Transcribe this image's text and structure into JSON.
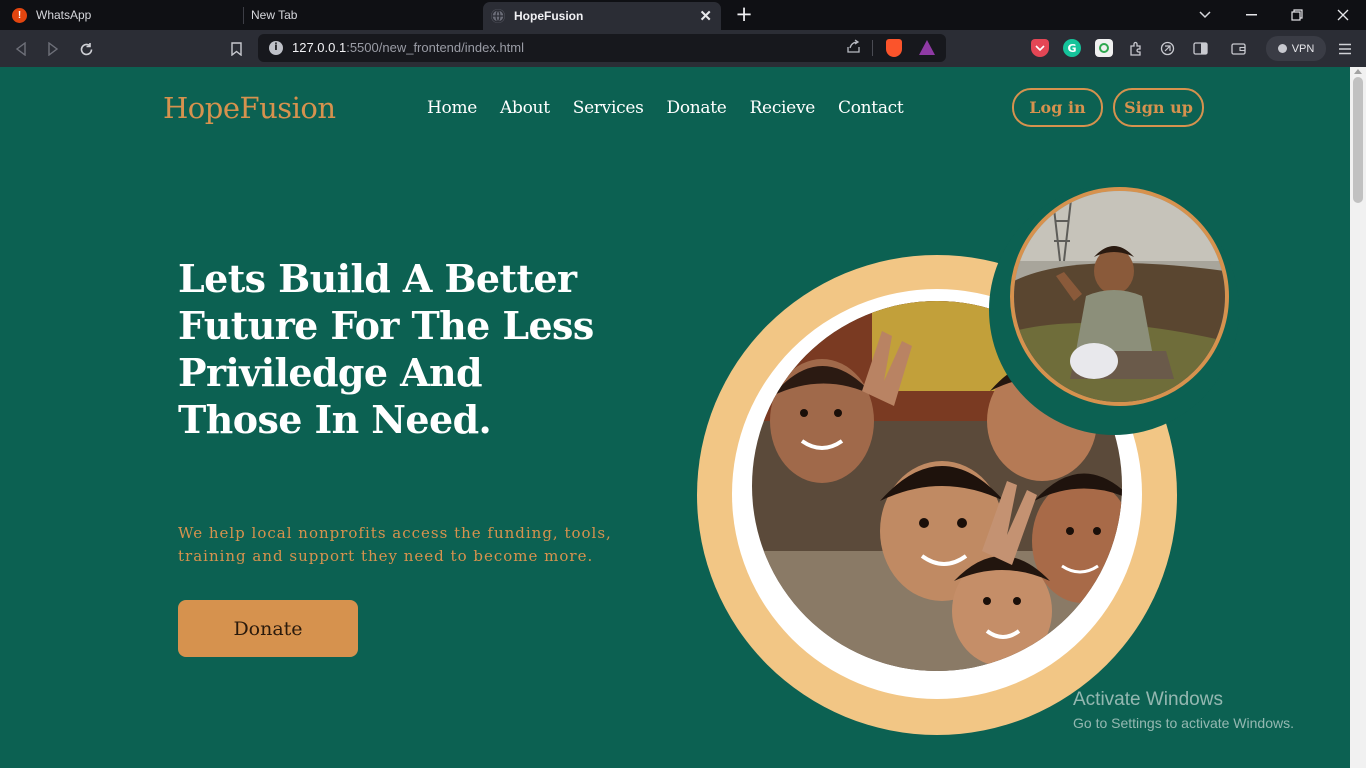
{
  "browser": {
    "tabs": [
      {
        "title": "WhatsApp",
        "icon": "whatsapp-notification-icon"
      },
      {
        "title": "New Tab",
        "icon": ""
      },
      {
        "title": "HopeFusion",
        "icon": "globe-icon",
        "active": true
      }
    ],
    "url_host": "127.0.0.1",
    "url_rest": ":5500/new_frontend/index.html",
    "vpn_label": "VPN",
    "whatsapp_badge": "!"
  },
  "site": {
    "logo": "HopeFusion",
    "nav": [
      "Home",
      "About",
      "Services",
      "Donate",
      "Recieve",
      "Contact"
    ],
    "login_label": "Log in",
    "signup_label": "Sign up",
    "hero_title": "Lets Build A Better Future For The Less Priviledge And Those In Need.",
    "hero_subtitle": "We help local nonprofits access the funding, tools, training and support they need to become more.",
    "donate_label": "Donate",
    "colors": {
      "background": "#0c6152",
      "accent": "#d6924e",
      "ring": "#f2c685",
      "text": "#ffffff"
    },
    "images": {
      "main": "group-of-smiling-children-photo",
      "secondary": "child-sitting-outdoors-photo"
    }
  },
  "os_watermark": {
    "title": "Activate Windows",
    "subtitle": "Go to Settings to activate Windows."
  }
}
